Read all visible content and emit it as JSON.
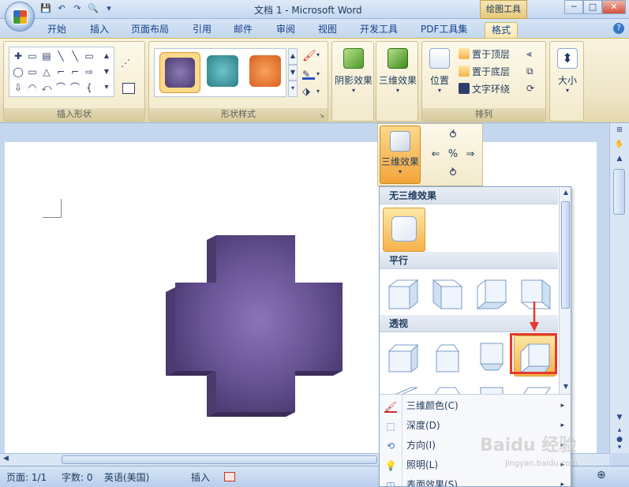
{
  "window": {
    "title": "文档 1 - Microsoft Word",
    "context_tab_title": "绘图工具",
    "minimize_glyph": "─",
    "maximize_glyph": "□",
    "close_glyph": "✕"
  },
  "quick_access": {
    "save_glyph": "💾",
    "undo_glyph": "↶",
    "redo_glyph": "↷",
    "preview_glyph": "🔍",
    "more_glyph": "▾"
  },
  "tabs": [
    "开始",
    "插入",
    "页面布局",
    "引用",
    "邮件",
    "审阅",
    "视图",
    "开发工具",
    "PDF工具集",
    "格式"
  ],
  "active_tab": "格式",
  "ribbon": {
    "insert_shapes_label": "插入形状",
    "shape_styles_label": "形状样式",
    "shadow_effects_label": "阴影效果",
    "three_d_effects_label": "三维效果",
    "arrange_label": "排列",
    "position_label": "位置",
    "bring_to_front": "置于顶层",
    "send_to_back": "置于底层",
    "text_wrap": "文字环绕",
    "size_label": "大小",
    "dropdown_glyph": "▾",
    "gallery_up_glyph": "▲",
    "gallery_down_glyph": "▼",
    "gallery_more_glyph": "▾",
    "shape_glyphs": [
      "✚",
      "▭",
      "▤",
      "╲",
      "╲",
      "▭",
      "◯",
      "▭",
      "△",
      "⌐",
      "⌐",
      "⇨",
      "⇩",
      "◠",
      "⤺",
      "⌒",
      "⌒",
      "{"
    ],
    "swatch_colors": [
      "#5b4c85",
      "#3b9aa3",
      "#e8762a"
    ],
    "size_glyph": "⬍"
  },
  "three_d_button": {
    "label": "三维效果",
    "tilt_glyphs": [
      "⥀",
      "⇐",
      "%",
      "⇒",
      "⥁"
    ]
  },
  "dropdown": {
    "sections": [
      "无三维效果",
      "平行",
      "透视"
    ],
    "menu_items": [
      {
        "label": "三维颜色(C)",
        "icon": "🖌"
      },
      {
        "label": "深度(D)",
        "icon": "⬚"
      },
      {
        "label": "方向(I)",
        "icon": "⟲"
      },
      {
        "label": "照明(L)",
        "icon": "💡"
      },
      {
        "label": "表面效果(S)",
        "icon": "◫"
      }
    ],
    "submenu_glyph": "▸"
  },
  "statusbar": {
    "page": "页面: 1/1",
    "words": "字数: 0",
    "language": "英语(美国)",
    "mode": "插入",
    "zoom_in_glyph": "⊕"
  },
  "watermark": {
    "main": "Baidu 经验",
    "sub": "jingyan.baidu.com"
  },
  "colors": {
    "shape_purple": "#675291",
    "highlight_orange": "#f6b24a",
    "arrow_red": "#e33a32"
  }
}
